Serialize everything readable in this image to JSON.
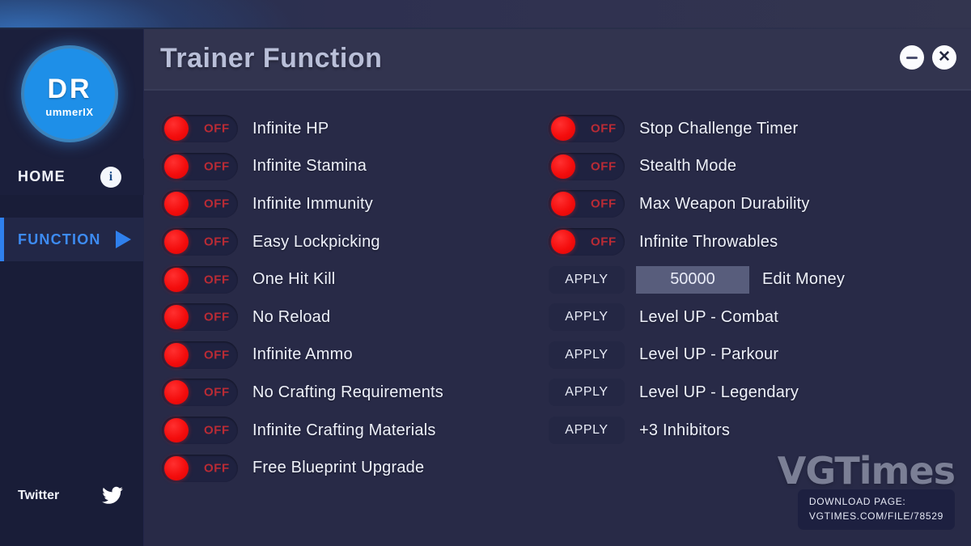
{
  "window": {
    "title": "Trainer Function",
    "minimize_label": "–",
    "close_label": "✕",
    "minimize_icon": "minimize-icon",
    "close_icon": "close-icon"
  },
  "sidebar": {
    "logo": {
      "main": "DR",
      "sub": "ummerIX"
    },
    "home": {
      "label": "HOME",
      "info_icon": "info-icon",
      "info_glyph": "i"
    },
    "function": {
      "label": "FUNCTION",
      "arrow_icon": "play-arrow-icon"
    },
    "twitter": {
      "label": "Twitter",
      "icon": "twitter-bird-icon"
    }
  },
  "toggles": {
    "state_label": "OFF"
  },
  "buttons": {
    "apply_label": "APPLY"
  },
  "left_column": [
    {
      "type": "toggle",
      "label": "Infinite HP",
      "state": "OFF"
    },
    {
      "type": "toggle",
      "label": "Infinite Stamina",
      "state": "OFF"
    },
    {
      "type": "toggle",
      "label": "Infinite Immunity",
      "state": "OFF"
    },
    {
      "type": "toggle",
      "label": "Easy Lockpicking",
      "state": "OFF"
    },
    {
      "type": "toggle",
      "label": "One Hit Kill",
      "state": "OFF"
    },
    {
      "type": "toggle",
      "label": "No Reload",
      "state": "OFF"
    },
    {
      "type": "toggle",
      "label": "Infinite Ammo",
      "state": "OFF"
    },
    {
      "type": "toggle",
      "label": "No Crafting Requirements",
      "state": "OFF"
    },
    {
      "type": "toggle",
      "label": "Infinite Crafting Materials",
      "state": "OFF"
    },
    {
      "type": "toggle",
      "label": "Free Blueprint Upgrade",
      "state": "OFF"
    }
  ],
  "right_column": [
    {
      "type": "toggle",
      "label": "Stop Challenge Timer",
      "state": "OFF"
    },
    {
      "type": "toggle",
      "label": "Stealth Mode",
      "state": "OFF"
    },
    {
      "type": "toggle",
      "label": "Max Weapon Durability",
      "state": "OFF"
    },
    {
      "type": "toggle",
      "label": "Infinite Throwables",
      "state": "OFF"
    },
    {
      "type": "apply_input",
      "label": "Edit Money",
      "button": "APPLY",
      "value": "50000"
    },
    {
      "type": "apply",
      "label": "Level UP - Combat",
      "button": "APPLY"
    },
    {
      "type": "apply",
      "label": "Level UP - Parkour",
      "button": "APPLY"
    },
    {
      "type": "apply",
      "label": "Level UP - Legendary",
      "button": "APPLY"
    },
    {
      "type": "apply",
      "label": "+3 Inhibitors",
      "button": "APPLY"
    }
  ],
  "watermark": {
    "brand": "VGTimes",
    "download_label": "DOWNLOAD PAGE:",
    "download_url": "VGTIMES.COM/FILE/78529"
  },
  "colors": {
    "accent_blue": "#2f80ed",
    "toggle_red": "#f40d0d",
    "off_text_red": "#b92b35",
    "sidebar_bg": "#191d38",
    "content_bg": "#282a47",
    "header_bg": "#32344f",
    "input_bg": "#585d7c"
  }
}
